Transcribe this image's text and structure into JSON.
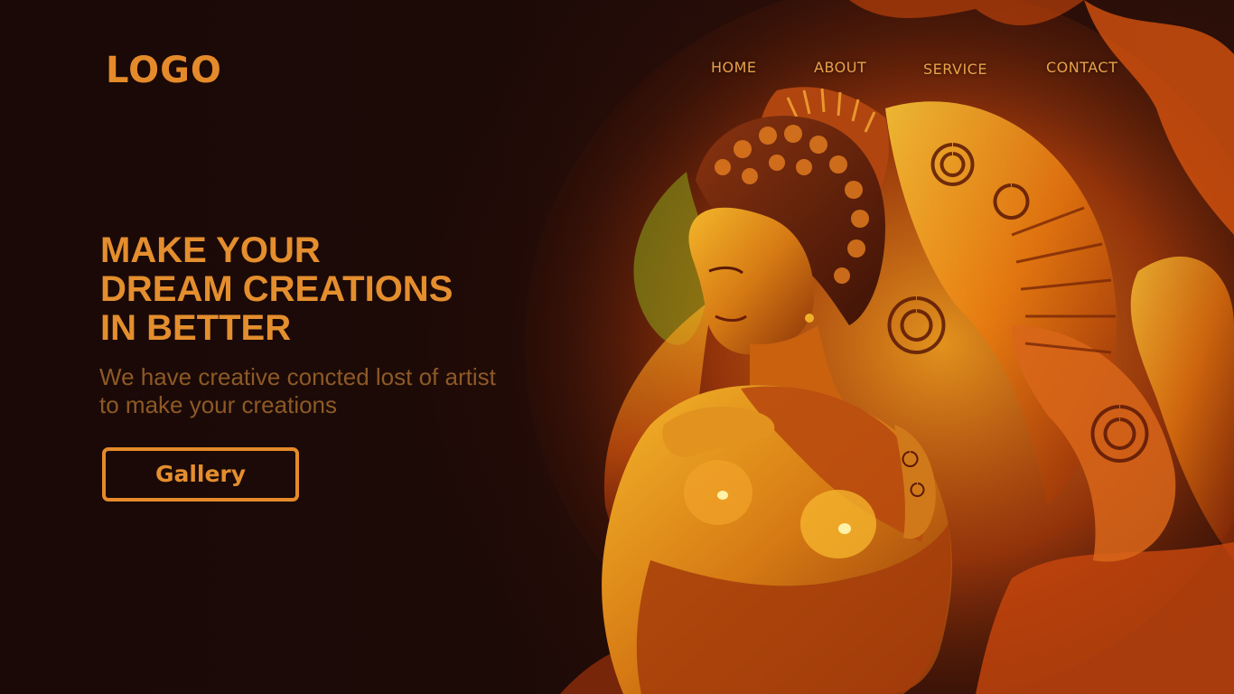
{
  "header": {
    "logo": "LOGO"
  },
  "nav": {
    "items": [
      {
        "label": "HOME"
      },
      {
        "label": "ABOUT"
      },
      {
        "label": "SERVICE"
      },
      {
        "label": "CONTACT"
      }
    ]
  },
  "hero": {
    "title_lines": [
      "MAKE YOUR",
      "DREAM CREATIONS",
      "IN BETTER"
    ],
    "subtitle_lines": [
      "We have creative concted lost of artist",
      "to make your creations"
    ],
    "cta_label": "Gallery"
  },
  "colors": {
    "accent": "#e58a2a",
    "subtitle": "#8d5a26",
    "background": "#1a0907",
    "nav_text": "#e8a24a"
  }
}
